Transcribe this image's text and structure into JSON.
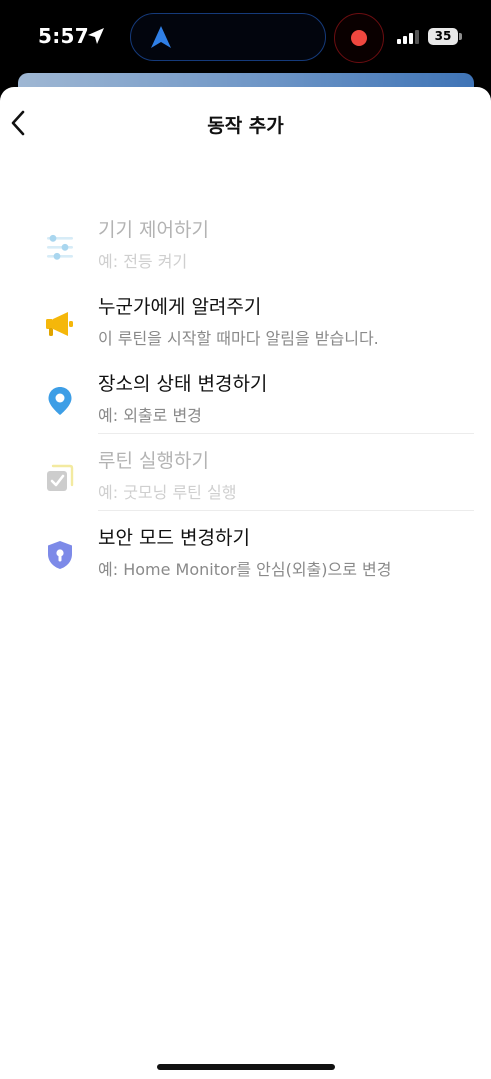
{
  "status_bar": {
    "time": "5:57",
    "battery": "35"
  },
  "header": {
    "title": "동작 추가"
  },
  "items": [
    {
      "title": "기기 제어하기",
      "subtitle": "예: 전등 켜기",
      "enabled": false,
      "icon": "sliders-icon",
      "color": "#9ed0ec"
    },
    {
      "title": "누군가에게 알려주기",
      "subtitle": "이 루틴을 시작할 때마다 알림을 받습니다.",
      "enabled": true,
      "icon": "megaphone-icon",
      "color": "#f5b70a"
    },
    {
      "title": "장소의 상태 변경하기",
      "subtitle": "예: 외출로 변경",
      "enabled": true,
      "icon": "location-pin-icon",
      "color": "#3d9ee6"
    },
    {
      "title": "루틴 실행하기",
      "subtitle": "예: 굿모닝 루틴 실행",
      "enabled": false,
      "icon": "routine-check-icon",
      "color": "#c9c9c9"
    },
    {
      "title": "보안 모드 변경하기",
      "subtitle": "예: Home Monitor를 안심(외출)으로 변경",
      "enabled": true,
      "icon": "security-shield-icon",
      "color": "#7d8ae8"
    }
  ]
}
